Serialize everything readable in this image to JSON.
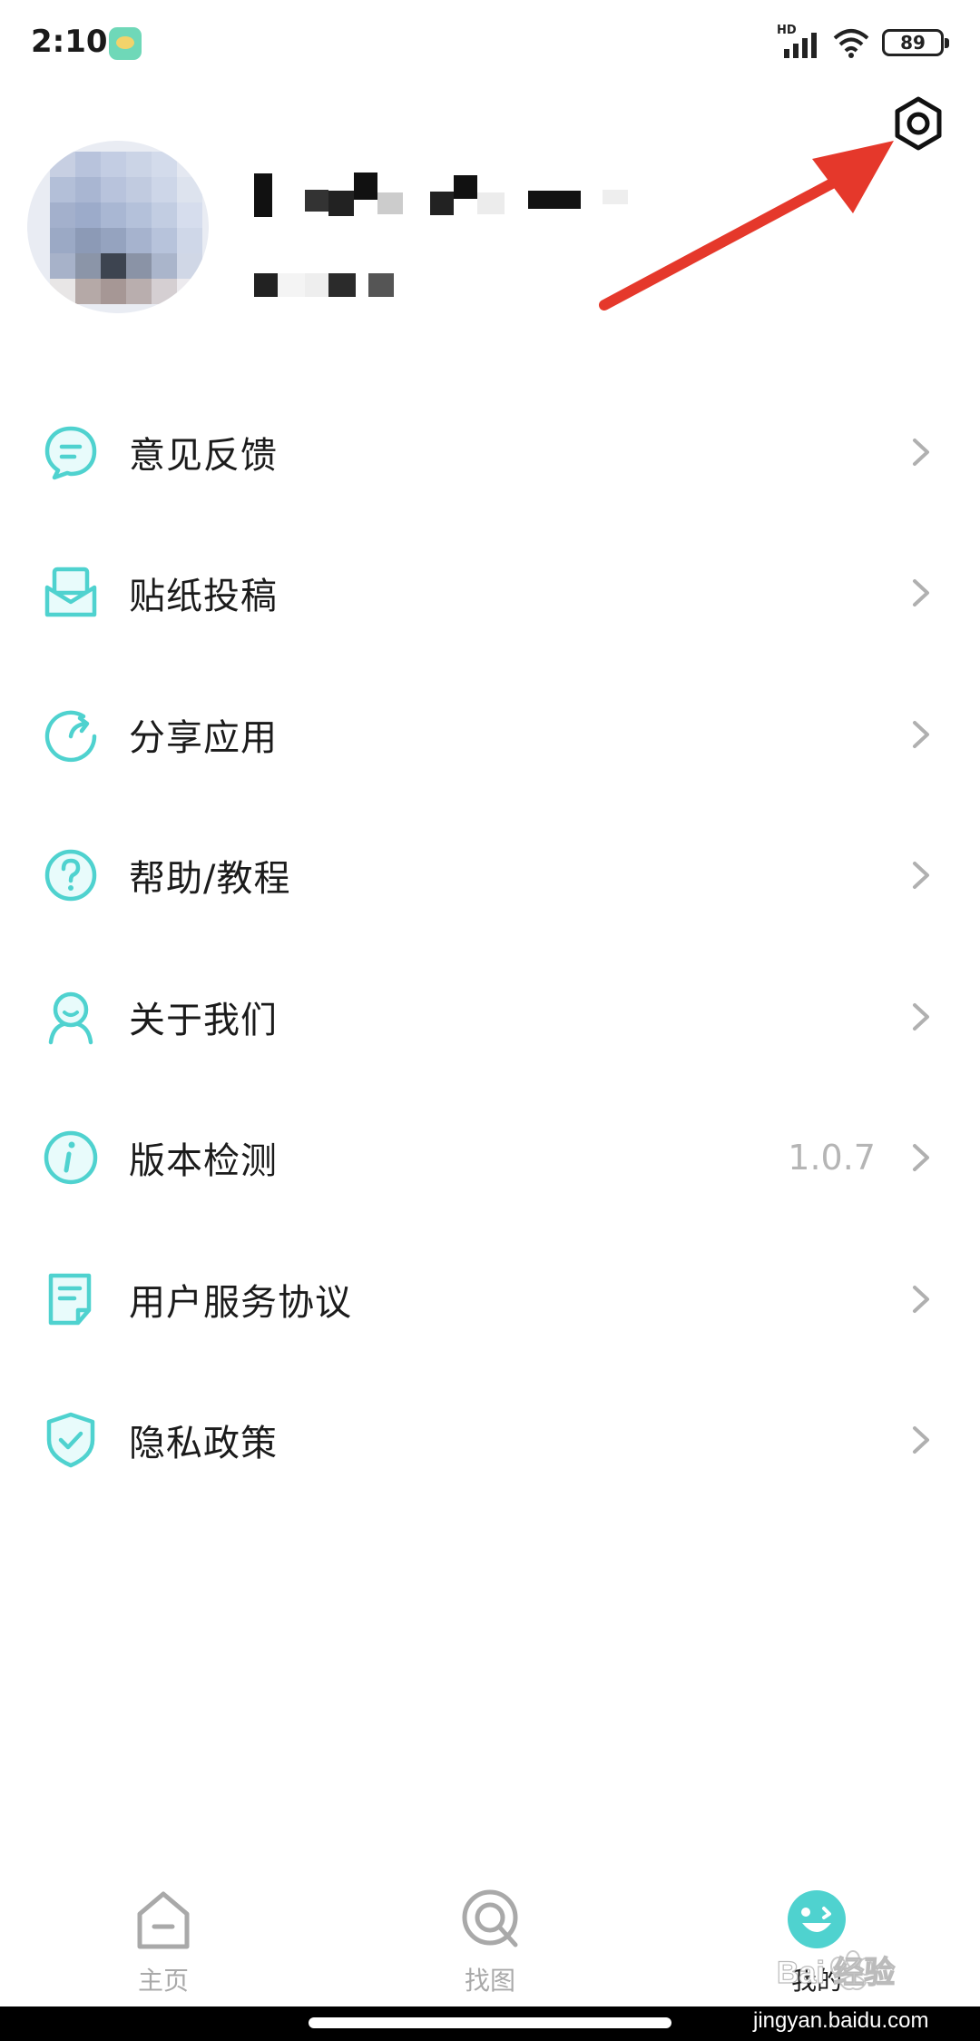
{
  "status_bar": {
    "time": "2:10",
    "network": "HD",
    "battery": "89"
  },
  "header": {
    "settings_icon": "settings-hex-icon"
  },
  "menu": {
    "items": [
      {
        "label": "意见反馈",
        "icon": "feedback-bubble-icon",
        "value": ""
      },
      {
        "label": "贴纸投稿",
        "icon": "mail-envelope-icon",
        "value": ""
      },
      {
        "label": "分享应用",
        "icon": "share-refresh-icon",
        "value": ""
      },
      {
        "label": "帮助/教程",
        "icon": "help-question-icon",
        "value": ""
      },
      {
        "label": "关于我们",
        "icon": "about-person-icon",
        "value": ""
      },
      {
        "label": "版本检测",
        "icon": "info-icon",
        "value": "1.0.7"
      },
      {
        "label": "用户服务协议",
        "icon": "document-icon",
        "value": ""
      },
      {
        "label": "隐私政策",
        "icon": "shield-check-icon",
        "value": ""
      }
    ]
  },
  "bottom_nav": {
    "items": [
      {
        "label": "主页",
        "icon": "home-icon",
        "active": false
      },
      {
        "label": "找图",
        "icon": "search-image-icon",
        "active": false
      },
      {
        "label": "我的",
        "icon": "smiley-face-icon",
        "active": true
      }
    ]
  },
  "watermark": {
    "text": "Bai 经验",
    "url": "jingyan.baidu.com"
  },
  "colors": {
    "accent": "#4fd2cf",
    "annotation": "#e5382b",
    "chevron": "#b0b0b0"
  }
}
